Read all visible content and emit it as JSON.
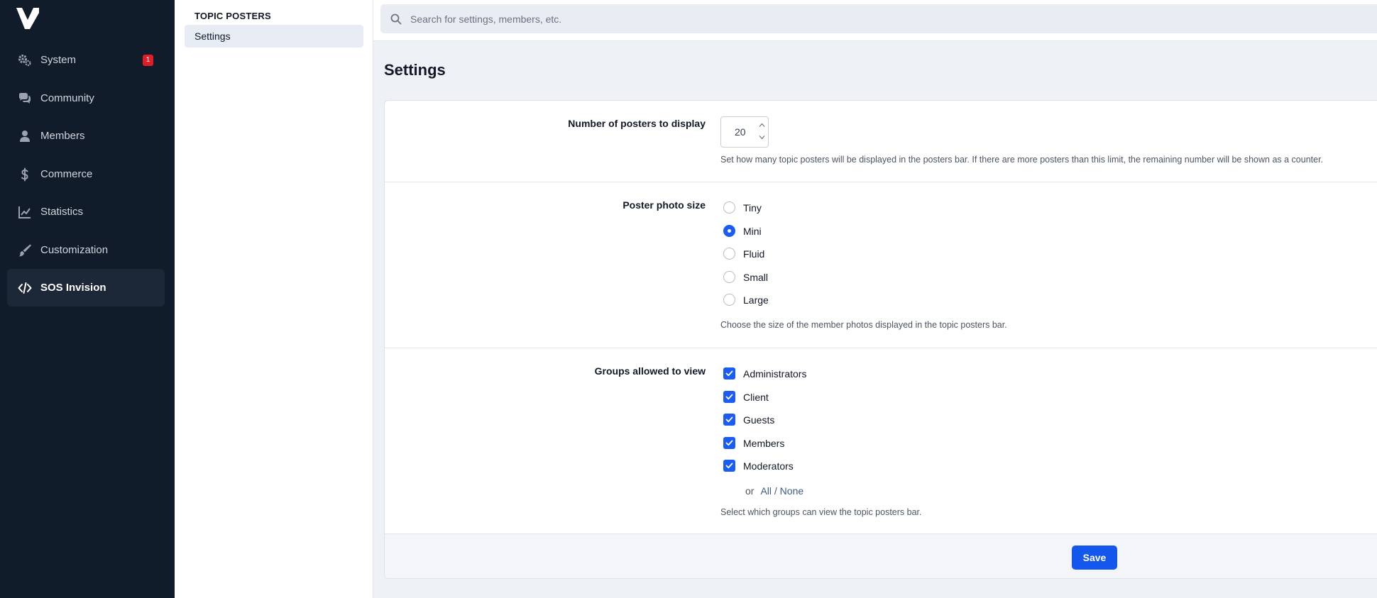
{
  "colors": {
    "sidebar_bg": "#111c2b",
    "accent": "#1b5cf5",
    "badge": "#e11d2a"
  },
  "sidebar": {
    "items": [
      {
        "label": "System",
        "icon": "gears-icon",
        "badge": "1"
      },
      {
        "label": "Community",
        "icon": "comments-icon"
      },
      {
        "label": "Members",
        "icon": "user-icon"
      },
      {
        "label": "Commerce",
        "icon": "dollar-icon"
      },
      {
        "label": "Statistics",
        "icon": "line-chart-icon"
      },
      {
        "label": "Customization",
        "icon": "brush-icon"
      },
      {
        "label": "SOS Invision",
        "icon": "code-icon",
        "active": true
      }
    ]
  },
  "submenu": {
    "title": "TOPIC POSTERS",
    "items": [
      {
        "label": "Settings",
        "active": true
      }
    ]
  },
  "search": {
    "placeholder": "Search for settings, members, etc."
  },
  "main": {
    "title": "Settings",
    "posters": {
      "label": "Number of posters to display",
      "value": "20",
      "description": "Set how many topic posters will be displayed in the posters bar. If there are more posters than this limit, the remaining number will be shown as a counter."
    },
    "photo_size": {
      "label": "Poster photo size",
      "options": [
        "Tiny",
        "Mini",
        "Fluid",
        "Small",
        "Large"
      ],
      "selected": "Mini",
      "description": "Choose the size of the member photos displayed in the topic posters bar."
    },
    "groups": {
      "label": "Groups allowed to view",
      "options": [
        "Administrators",
        "Client",
        "Guests",
        "Members",
        "Moderators"
      ],
      "checked": [
        "Administrators",
        "Client",
        "Guests",
        "Members",
        "Moderators"
      ],
      "or_text": "or",
      "all_none": "All / None",
      "description": "Select which groups can view the topic posters bar."
    },
    "save_label": "Save"
  }
}
